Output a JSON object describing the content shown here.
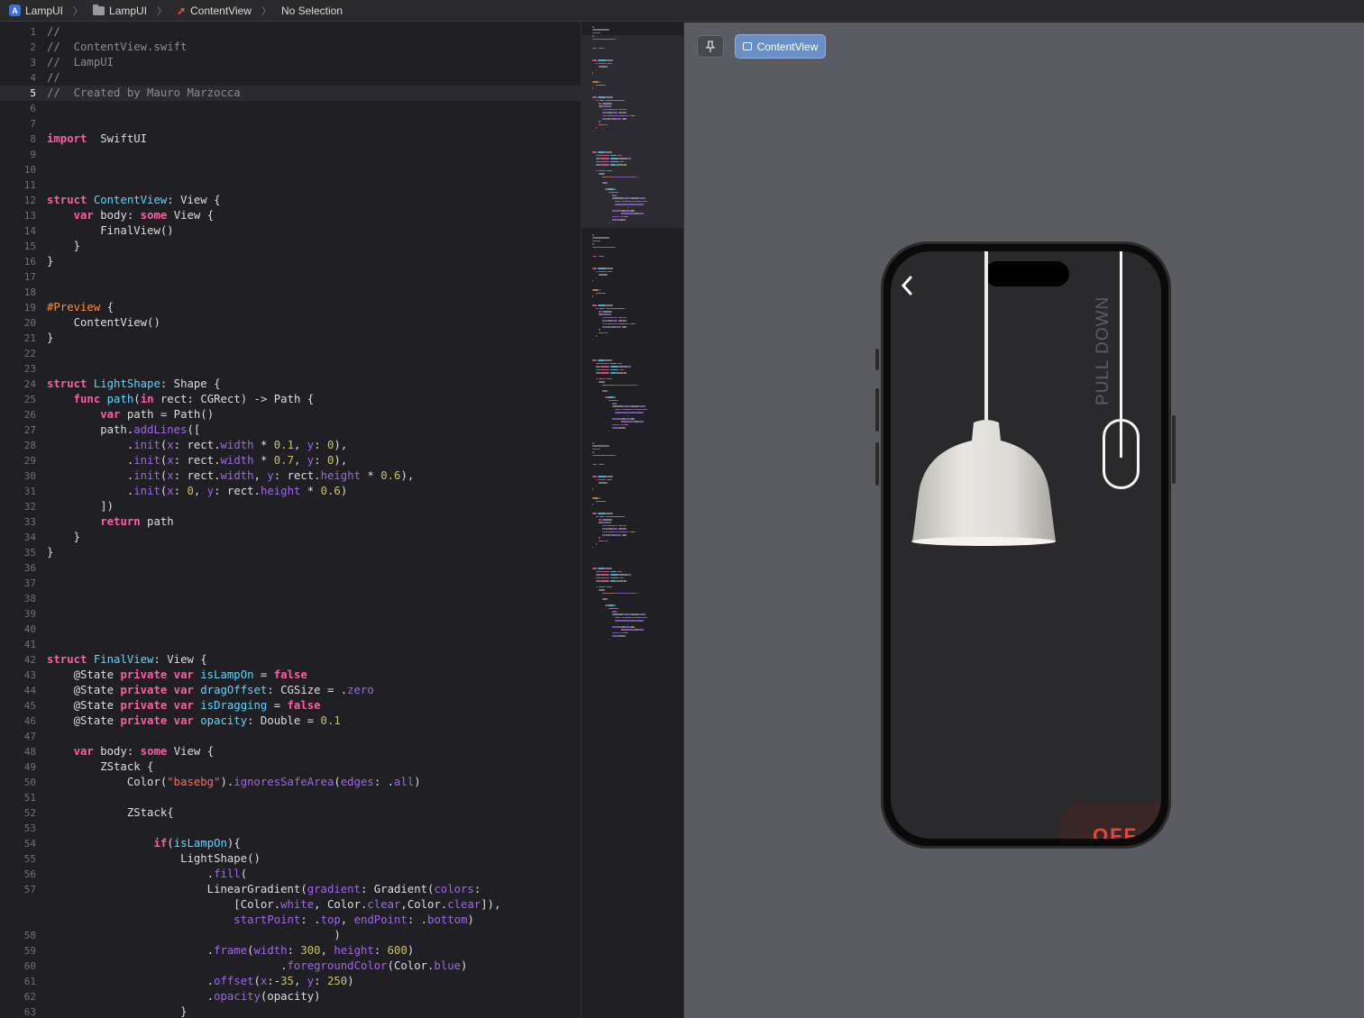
{
  "jumpbar": {
    "project": "LampUI",
    "group": "LampUI",
    "file": "ContentView",
    "selection": "No Selection"
  },
  "editor": {
    "current_line": 5,
    "lines": [
      {
        "n": 1,
        "tokens": [
          [
            "cm",
            "//"
          ]
        ]
      },
      {
        "n": 2,
        "tokens": [
          [
            "cm",
            "//  ContentView.swift"
          ]
        ]
      },
      {
        "n": 3,
        "tokens": [
          [
            "cm",
            "//  LampUI"
          ]
        ]
      },
      {
        "n": 4,
        "tokens": [
          [
            "cm",
            "//"
          ]
        ]
      },
      {
        "n": 5,
        "tokens": [
          [
            "cm",
            "//  Created by Mauro Marzocca"
          ]
        ]
      },
      {
        "n": 6,
        "tokens": []
      },
      {
        "n": 7,
        "tokens": []
      },
      {
        "n": 8,
        "tokens": [
          [
            "kw",
            "import"
          ],
          [
            "",
            "  SwiftUI"
          ]
        ]
      },
      {
        "n": 9,
        "tokens": []
      },
      {
        "n": 10,
        "tokens": []
      },
      {
        "n": 11,
        "tokens": []
      },
      {
        "n": 12,
        "tokens": [
          [
            "kw",
            "struct"
          ],
          [
            "ty",
            " ContentView"
          ],
          [
            "",
            ": View {"
          ]
        ]
      },
      {
        "n": 13,
        "tokens": [
          [
            "",
            "    "
          ],
          [
            "kw",
            "var"
          ],
          [
            "",
            " body: "
          ],
          [
            "kw",
            "some"
          ],
          [
            "",
            " View {"
          ]
        ]
      },
      {
        "n": 14,
        "tokens": [
          [
            "",
            "        FinalView()"
          ]
        ]
      },
      {
        "n": 15,
        "tokens": [
          [
            "",
            "    }"
          ]
        ]
      },
      {
        "n": 16,
        "tokens": [
          [
            "",
            "}"
          ]
        ]
      },
      {
        "n": 17,
        "tokens": []
      },
      {
        "n": 18,
        "tokens": []
      },
      {
        "n": 19,
        "tokens": [
          [
            "at",
            "#Preview"
          ],
          [
            "",
            " {"
          ]
        ]
      },
      {
        "n": 20,
        "tokens": [
          [
            "",
            "    ContentView()"
          ]
        ]
      },
      {
        "n": 21,
        "tokens": [
          [
            "",
            "}"
          ]
        ]
      },
      {
        "n": 22,
        "tokens": []
      },
      {
        "n": 23,
        "tokens": []
      },
      {
        "n": 24,
        "tokens": [
          [
            "kw",
            "struct"
          ],
          [
            "ty",
            " LightShape"
          ],
          [
            "",
            ": Shape {"
          ]
        ]
      },
      {
        "n": 25,
        "tokens": [
          [
            "",
            "    "
          ],
          [
            "kw",
            "func"
          ],
          [
            "ty",
            " path"
          ],
          [
            "",
            "("
          ],
          [
            "kw",
            "in"
          ],
          [
            "",
            " rect: CGRect) -> Path {"
          ]
        ]
      },
      {
        "n": 26,
        "tokens": [
          [
            "",
            "        "
          ],
          [
            "kw",
            "var"
          ],
          [
            "",
            " path = Path()"
          ]
        ]
      },
      {
        "n": 27,
        "tokens": [
          [
            "",
            "        path."
          ],
          [
            "fn",
            "addLines"
          ],
          [
            "",
            "(["
          ]
        ]
      },
      {
        "n": 28,
        "tokens": [
          [
            "",
            "            ."
          ],
          [
            "fn",
            "init"
          ],
          [
            "",
            "("
          ],
          [
            "pr",
            "x"
          ],
          [
            "",
            ": rect."
          ],
          [
            "pr",
            "width"
          ],
          [
            "",
            " * "
          ],
          [
            "nm",
            "0.1"
          ],
          [
            "",
            ", "
          ],
          [
            "pr",
            "y"
          ],
          [
            "",
            ": "
          ],
          [
            "nm",
            "0"
          ],
          [
            "",
            "),"
          ]
        ]
      },
      {
        "n": 29,
        "tokens": [
          [
            "",
            "            ."
          ],
          [
            "fn",
            "init"
          ],
          [
            "",
            "("
          ],
          [
            "pr",
            "x"
          ],
          [
            "",
            ": rect."
          ],
          [
            "pr",
            "width"
          ],
          [
            "",
            " * "
          ],
          [
            "nm",
            "0.7"
          ],
          [
            "",
            ", "
          ],
          [
            "pr",
            "y"
          ],
          [
            "",
            ": "
          ],
          [
            "nm",
            "0"
          ],
          [
            "",
            "),"
          ]
        ]
      },
      {
        "n": 30,
        "tokens": [
          [
            "",
            "            ."
          ],
          [
            "fn",
            "init"
          ],
          [
            "",
            "("
          ],
          [
            "pr",
            "x"
          ],
          [
            "",
            ": rect."
          ],
          [
            "pr",
            "width"
          ],
          [
            "",
            ", "
          ],
          [
            "pr",
            "y"
          ],
          [
            "",
            ": rect."
          ],
          [
            "pr",
            "height"
          ],
          [
            "",
            " * "
          ],
          [
            "nm",
            "0.6"
          ],
          [
            "",
            "),"
          ]
        ]
      },
      {
        "n": 31,
        "tokens": [
          [
            "",
            "            ."
          ],
          [
            "fn",
            "init"
          ],
          [
            "",
            "("
          ],
          [
            "pr",
            "x"
          ],
          [
            "",
            ": "
          ],
          [
            "nm",
            "0"
          ],
          [
            "",
            ", "
          ],
          [
            "pr",
            "y"
          ],
          [
            "",
            ": rect."
          ],
          [
            "pr",
            "height"
          ],
          [
            "",
            " * "
          ],
          [
            "nm",
            "0.6"
          ],
          [
            "",
            ")"
          ]
        ]
      },
      {
        "n": 32,
        "tokens": [
          [
            "",
            "        ])"
          ]
        ]
      },
      {
        "n": 33,
        "tokens": [
          [
            "",
            "        "
          ],
          [
            "kw",
            "return"
          ],
          [
            "",
            " path"
          ]
        ]
      },
      {
        "n": 34,
        "tokens": [
          [
            "",
            "    }"
          ]
        ]
      },
      {
        "n": 35,
        "tokens": [
          [
            "",
            "}"
          ]
        ]
      },
      {
        "n": 36,
        "tokens": []
      },
      {
        "n": 37,
        "tokens": []
      },
      {
        "n": 38,
        "tokens": []
      },
      {
        "n": 39,
        "tokens": []
      },
      {
        "n": 40,
        "tokens": []
      },
      {
        "n": 41,
        "tokens": []
      },
      {
        "n": 42,
        "tokens": [
          [
            "kw",
            "struct"
          ],
          [
            "ty",
            " FinalView"
          ],
          [
            "",
            ": View {"
          ]
        ]
      },
      {
        "n": 43,
        "tokens": [
          [
            "",
            "    @State "
          ],
          [
            "kw",
            "private var"
          ],
          [
            "ty",
            " isLampOn"
          ],
          [
            "",
            " = "
          ],
          [
            "kw",
            "false"
          ]
        ]
      },
      {
        "n": 44,
        "tokens": [
          [
            "",
            "    @State "
          ],
          [
            "kw",
            "private var"
          ],
          [
            "ty",
            " dragOffset"
          ],
          [
            "",
            ": CGSize = ."
          ],
          [
            "pr",
            "zero"
          ]
        ]
      },
      {
        "n": 45,
        "tokens": [
          [
            "",
            "    @State "
          ],
          [
            "kw",
            "private var"
          ],
          [
            "ty",
            " isDragging"
          ],
          [
            "",
            " = "
          ],
          [
            "kw",
            "false"
          ]
        ]
      },
      {
        "n": 46,
        "tokens": [
          [
            "",
            "    @State "
          ],
          [
            "kw",
            "private var"
          ],
          [
            "ty",
            " opacity"
          ],
          [
            "",
            ": Double = "
          ],
          [
            "nm",
            "0.1"
          ]
        ]
      },
      {
        "n": 47,
        "tokens": []
      },
      {
        "n": 48,
        "tokens": [
          [
            "",
            "    "
          ],
          [
            "kw",
            "var"
          ],
          [
            "",
            " body: "
          ],
          [
            "kw",
            "some"
          ],
          [
            "",
            " View {"
          ]
        ]
      },
      {
        "n": 49,
        "tokens": [
          [
            "",
            "        ZStack {"
          ]
        ]
      },
      {
        "n": 50,
        "tokens": [
          [
            "",
            "            Color("
          ],
          [
            "st",
            "\"basebg\""
          ],
          [
            "",
            ")."
          ],
          [
            "fn",
            "ignoresSafeArea"
          ],
          [
            "",
            "("
          ],
          [
            "pr",
            "edges"
          ],
          [
            "",
            ": ."
          ],
          [
            "pr",
            "all"
          ],
          [
            "",
            ")"
          ]
        ]
      },
      {
        "n": 51,
        "tokens": []
      },
      {
        "n": 52,
        "tokens": [
          [
            "",
            "            ZStack{"
          ]
        ]
      },
      {
        "n": 53,
        "tokens": []
      },
      {
        "n": 54,
        "tokens": [
          [
            "",
            "                "
          ],
          [
            "kw",
            "if"
          ],
          [
            "",
            "("
          ],
          [
            "ty",
            "isLampOn"
          ],
          [
            "",
            "){"
          ]
        ]
      },
      {
        "n": 55,
        "tokens": [
          [
            "",
            "                    LightShape()"
          ]
        ]
      },
      {
        "n": 56,
        "tokens": [
          [
            "",
            "                        ."
          ],
          [
            "fn",
            "fill"
          ],
          [
            "",
            "("
          ]
        ]
      },
      {
        "n": 57,
        "tokens": [
          [
            "",
            "                        LinearGradient("
          ],
          [
            "pr",
            "gradient"
          ],
          [
            "",
            ": Gradient("
          ],
          [
            "pr",
            "colors"
          ],
          [
            "",
            ":"
          ]
        ]
      },
      {
        "n": "",
        "tokens": [
          [
            "",
            "                            [Color."
          ],
          [
            "pr",
            "white"
          ],
          [
            "",
            ", Color."
          ],
          [
            "pr",
            "clear"
          ],
          [
            "",
            ",Color."
          ],
          [
            "pr",
            "clear"
          ],
          [
            "",
            "]),"
          ]
        ]
      },
      {
        "n": "",
        "tokens": [
          [
            "",
            "                            "
          ],
          [
            "pr",
            "startPoint"
          ],
          [
            "",
            ": ."
          ],
          [
            "pr",
            "top"
          ],
          [
            "",
            ", "
          ],
          [
            "pr",
            "endPoint"
          ],
          [
            "",
            ": ."
          ],
          [
            "pr",
            "bottom"
          ],
          [
            "",
            ")"
          ]
        ]
      },
      {
        "n": 58,
        "tokens": [
          [
            "",
            "                                           )"
          ]
        ]
      },
      {
        "n": 59,
        "tokens": [
          [
            "",
            "                        ."
          ],
          [
            "fn",
            "frame"
          ],
          [
            "",
            "("
          ],
          [
            "pr",
            "width"
          ],
          [
            "",
            ": "
          ],
          [
            "nm",
            "300"
          ],
          [
            "",
            ", "
          ],
          [
            "pr",
            "height"
          ],
          [
            "",
            ": "
          ],
          [
            "nm",
            "600"
          ],
          [
            "",
            ")"
          ]
        ]
      },
      {
        "n": 60,
        "tokens": [
          [
            "",
            "                                   ."
          ],
          [
            "fn",
            "foregroundColor"
          ],
          [
            "",
            "(Color."
          ],
          [
            "pr",
            "blue"
          ],
          [
            "",
            ")"
          ]
        ]
      },
      {
        "n": 61,
        "tokens": [
          [
            "",
            "                        ."
          ],
          [
            "fn",
            "offset"
          ],
          [
            "",
            "("
          ],
          [
            "pr",
            "x"
          ],
          [
            "",
            ":-"
          ],
          [
            "nm",
            "35"
          ],
          [
            "",
            ", "
          ],
          [
            "pr",
            "y"
          ],
          [
            "",
            ": "
          ],
          [
            "nm",
            "250"
          ],
          [
            "",
            ")"
          ]
        ]
      },
      {
        "n": 62,
        "tokens": [
          [
            "",
            "                        ."
          ],
          [
            "fn",
            "opacity"
          ],
          [
            "",
            "(opacity)"
          ]
        ]
      },
      {
        "n": 63,
        "tokens": [
          [
            "",
            "                    }"
          ]
        ]
      }
    ]
  },
  "canvas": {
    "pin_icon": "pin-icon",
    "preview_label": "ContentView"
  },
  "preview": {
    "back_icon": "chevron-left-icon",
    "pull_text": "PULL DOWN",
    "off_label": "OFF",
    "accent_off": "#e8463c"
  }
}
